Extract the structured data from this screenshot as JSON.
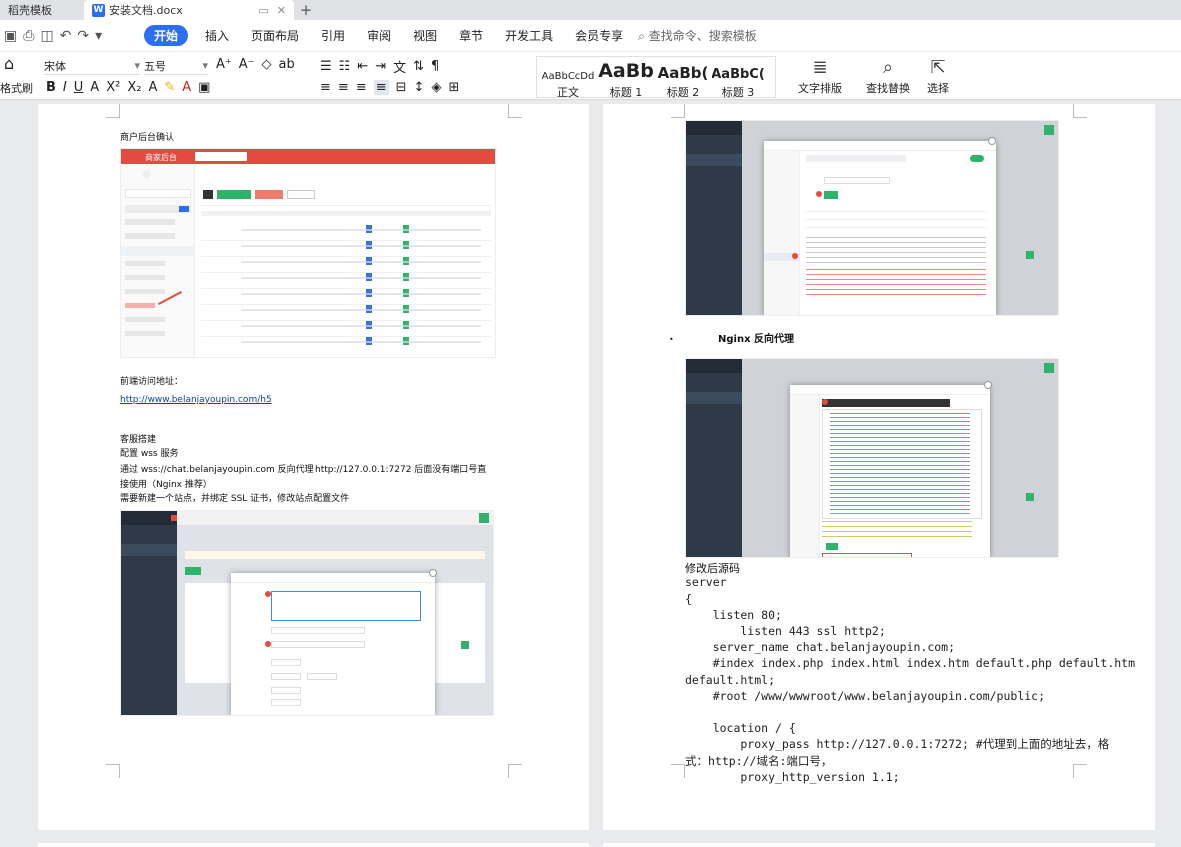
{
  "window": {
    "tabs": [
      {
        "label": "稻壳模板"
      },
      {
        "label": "安装文档.docx"
      }
    ],
    "new_tab": "+"
  },
  "menubar": {
    "items": [
      "开始",
      "插入",
      "页面布局",
      "引用",
      "审阅",
      "视图",
      "章节",
      "开发工具",
      "会员专享"
    ],
    "search_placeholder": "查找命令、搜索模板"
  },
  "ribbon": {
    "format_painter": "格式刷",
    "font_name": "宋体",
    "font_size": "五号",
    "styles": [
      {
        "preview": "AaBbCcDd",
        "label": "正文"
      },
      {
        "preview": "AaBb",
        "label": "标题 1"
      },
      {
        "preview": "AaBb(",
        "label": "标题 2"
      },
      {
        "preview": "AaBbC(",
        "label": "标题 3"
      }
    ],
    "text_layout": "文字排版",
    "find_replace": "查找替换",
    "select": "选择"
  },
  "doc_left": {
    "heading": "商户后台确认",
    "front_label": "前端访问地址：",
    "front_url": "http://www.belanjayoupin.com/h5",
    "cs_title": "客服搭建",
    "cs_line1": "配置 wss 服务",
    "cs_line2a": "通过 wss://chat.belanjayoupin.com 反向代理",
    "cs_line2b": "http://127.0.0.1:7272 后面没有端口号直",
    "cs_line3": "接使用（Nginx 推荐）",
    "cs_line4": "需要新建一个站点，并绑定 SSL 证书，修改站点配置文件",
    "shot1_title": "商家后台"
  },
  "doc_right": {
    "nginx_heading": "Nginx 反向代理",
    "after_label": "修改后源码",
    "code_lines": [
      "server",
      "{",
      "    listen 80;",
      "        listen 443 ssl http2;",
      "    server_name chat.belanjayoupin.com;",
      "    #index index.php index.html index.htm default.php default.htm",
      "default.html;",
      "    #root /www/wwwroot/www.belanjayoupin.com/public;",
      "",
      "    location / {",
      "        proxy_pass http://127.0.0.1:7272; #代理到上面的地址去，格",
      "式：http://域名:端口号，",
      "        proxy_http_version 1.1;"
    ]
  }
}
